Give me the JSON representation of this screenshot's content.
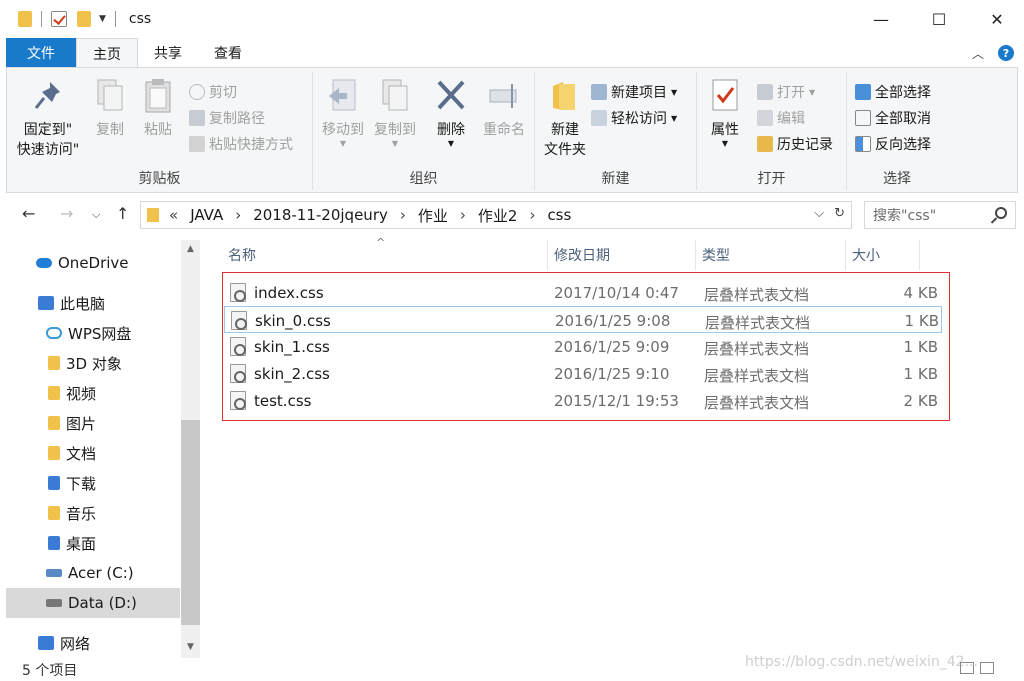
{
  "window": {
    "title": "css",
    "minimize": "—",
    "maximize": "☐",
    "close": "✕"
  },
  "tabs": [
    "文件",
    "主页",
    "共享",
    "查看"
  ],
  "ribbon": {
    "clipboard": {
      "label": "剪贴板",
      "pin_line1": "固定到\"",
      "pin_line2": "快速访问\"",
      "copy": "复制",
      "paste": "粘贴",
      "cut": "剪切",
      "copy_path": "复制路径",
      "paste_shortcut": "粘贴快捷方式"
    },
    "organize": {
      "label": "组织",
      "move_to": "移动到",
      "copy_to": "复制到",
      "delete": "删除",
      "rename": "重命名"
    },
    "new": {
      "label": "新建",
      "new_folder_line1": "新建",
      "new_folder_line2": "文件夹",
      "new_item": "新建项目",
      "easy_access": "轻松访问"
    },
    "open": {
      "label": "打开",
      "properties": "属性",
      "open": "打开",
      "edit": "编辑",
      "history": "历史记录"
    },
    "select": {
      "label": "选择",
      "select_all": "全部选择",
      "select_none": "全部取消",
      "invert": "反向选择"
    }
  },
  "address": {
    "prefix": "«",
    "crumbs": [
      "JAVA",
      "2018-11-20jqeury",
      "作业",
      "作业2",
      "css"
    ],
    "separator": "›"
  },
  "search": {
    "placeholder": "搜索\"css\""
  },
  "sidebar": {
    "items": [
      {
        "label": "OneDrive",
        "color": "#1f7fd8"
      },
      {
        "label": "此电脑",
        "color": "#3a7bd5"
      },
      {
        "label": "WPS网盘",
        "color": "#3a9ad9"
      },
      {
        "label": "3D 对象",
        "color": "#f0c14b"
      },
      {
        "label": "视频",
        "color": "#f0c14b"
      },
      {
        "label": "图片",
        "color": "#f0c14b"
      },
      {
        "label": "文档",
        "color": "#f0c14b"
      },
      {
        "label": "下载",
        "color": "#3a7bd5"
      },
      {
        "label": "音乐",
        "color": "#f0c14b"
      },
      {
        "label": "桌面",
        "color": "#3a7bd5"
      },
      {
        "label": "Acer (C:)",
        "color": "#5a8ac6"
      },
      {
        "label": "Data (D:)",
        "color": "#777777"
      },
      {
        "label": "网络",
        "color": "#3a7bd5"
      }
    ]
  },
  "columns": [
    "名称",
    "修改日期",
    "类型",
    "大小"
  ],
  "files": [
    {
      "name": "index.css",
      "date": "2017/10/14 0:47",
      "type": "层叠样式表文档",
      "size": "4 KB"
    },
    {
      "name": "skin_0.css",
      "date": "2016/1/25 9:08",
      "type": "层叠样式表文档",
      "size": "1 KB"
    },
    {
      "name": "skin_1.css",
      "date": "2016/1/25 9:09",
      "type": "层叠样式表文档",
      "size": "1 KB"
    },
    {
      "name": "skin_2.css",
      "date": "2016/1/25 9:10",
      "type": "层叠样式表文档",
      "size": "1 KB"
    },
    {
      "name": "test.css",
      "date": "2015/12/1 19:53",
      "type": "层叠样式表文档",
      "size": "2 KB"
    }
  ],
  "status": {
    "count": "5 个项目",
    "watermark": "https://blog.csdn.net/weixin_42..."
  },
  "accent": "#1979ca"
}
